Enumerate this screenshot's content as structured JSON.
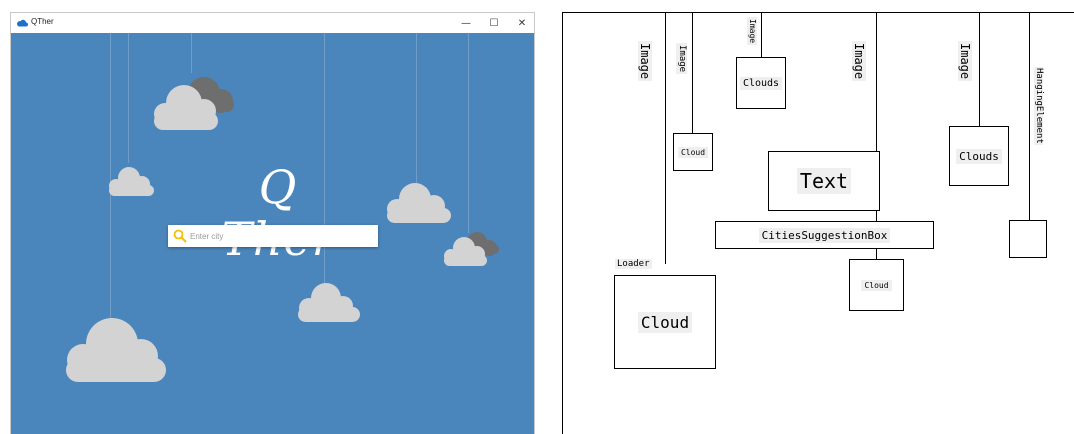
{
  "window": {
    "title": "QTher",
    "minimize_glyph": "—",
    "maximize_glyph": "☐",
    "close_glyph": "✕",
    "background": "#4a86bc"
  },
  "app": {
    "logo_text": "Q Ther",
    "search": {
      "placeholder": "Enter city",
      "value": ""
    },
    "colors": {
      "cloud_light": "#d3d3d3",
      "cloud_dark": "#6e6e6e",
      "search_icon": "#f2c200"
    }
  },
  "diagram": {
    "labels": {
      "image_1": "Image",
      "image_2": "Image",
      "image_3": "Image",
      "image_4": "Image",
      "image_5": "Image",
      "clouds_top": "Clouds",
      "cloud_small": "Cloud",
      "text_box": "Text",
      "clouds_right": "Clouds",
      "hanging_element": "HangingElement",
      "cities_suggestion_box": "CitiesSuggestionBox",
      "cloud_lower": "Cloud",
      "loader": "Loader",
      "cloud_big": "Cloud"
    }
  }
}
